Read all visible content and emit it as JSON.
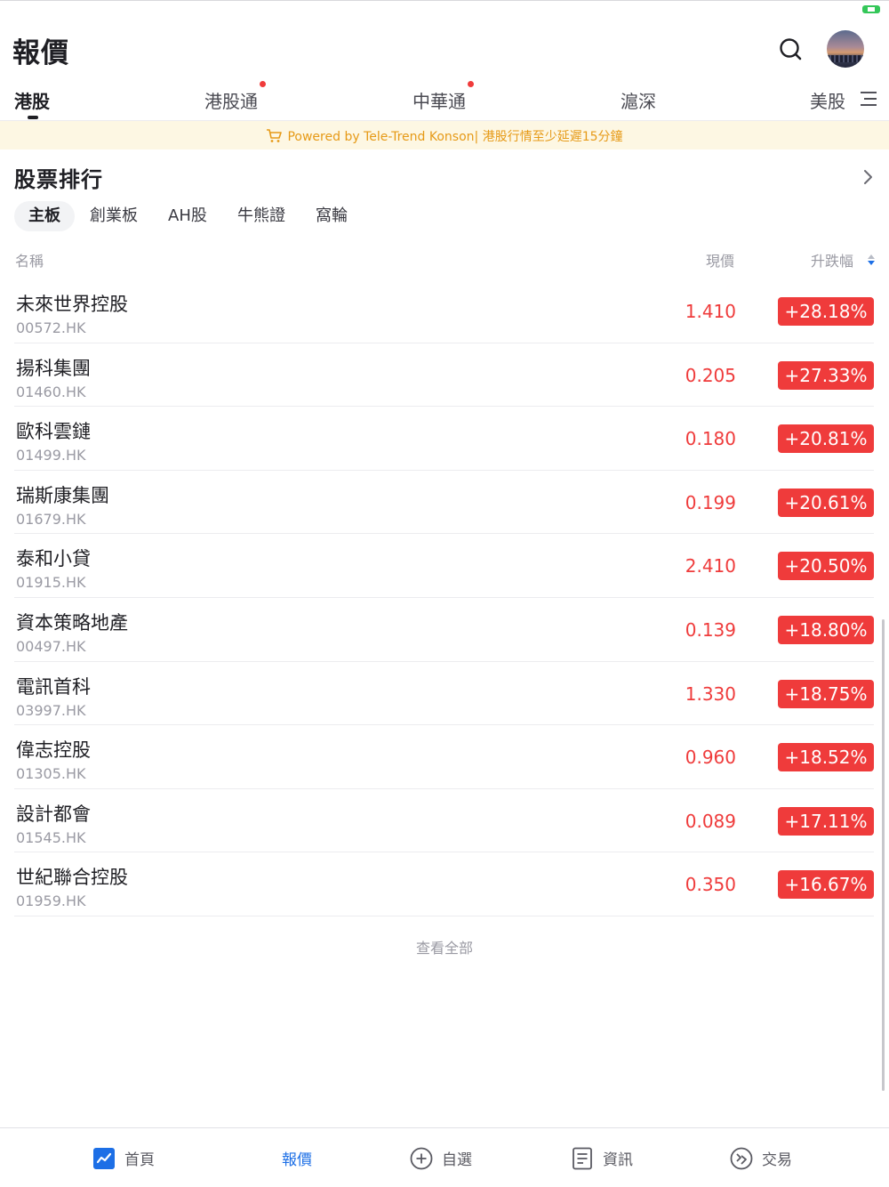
{
  "header": {
    "title": "報價"
  },
  "tabs": [
    {
      "label": "港股",
      "active": true,
      "dot": false
    },
    {
      "label": "港股通",
      "active": false,
      "dot": true
    },
    {
      "label": "中華通",
      "active": false,
      "dot": true
    },
    {
      "label": "滬深",
      "active": false,
      "dot": false
    },
    {
      "label": "美股",
      "active": false,
      "dot": false
    }
  ],
  "notice": {
    "text": "Powered by Tele-Trend Konson| 港股行情至少延遲15分鐘"
  },
  "ranking": {
    "title": "股票排行",
    "subtabs": [
      "主板",
      "創業板",
      "AH股",
      "牛熊證",
      "窩輪"
    ],
    "columns": {
      "name": "名稱",
      "price": "現價",
      "change": "升跌幅"
    },
    "rows": [
      {
        "name": "未來世界控股",
        "code": "00572.HK",
        "price": "1.410",
        "change": "+28.18%"
      },
      {
        "name": "揚科集團",
        "code": "01460.HK",
        "price": "0.205",
        "change": "+27.33%"
      },
      {
        "name": "歐科雲鏈",
        "code": "01499.HK",
        "price": "0.180",
        "change": "+20.81%"
      },
      {
        "name": "瑞斯康集團",
        "code": "01679.HK",
        "price": "0.199",
        "change": "+20.61%"
      },
      {
        "name": "泰和小貸",
        "code": "01915.HK",
        "price": "2.410",
        "change": "+20.50%"
      },
      {
        "name": "資本策略地產",
        "code": "00497.HK",
        "price": "0.139",
        "change": "+18.80%"
      },
      {
        "name": "電訊首科",
        "code": "03997.HK",
        "price": "1.330",
        "change": "+18.75%"
      },
      {
        "name": "偉志控股",
        "code": "01305.HK",
        "price": "0.960",
        "change": "+18.52%"
      },
      {
        "name": "設計都會",
        "code": "01545.HK",
        "price": "0.089",
        "change": "+17.11%"
      },
      {
        "name": "世紀聯合控股",
        "code": "01959.HK",
        "price": "0.350",
        "change": "+16.67%"
      }
    ],
    "view_all": "查看全部"
  },
  "bottom_nav": [
    {
      "label": "首頁",
      "icon": "chart-icon"
    },
    {
      "label": "報價",
      "icon": "",
      "active": true
    },
    {
      "label": "自選",
      "icon": "add-circle-icon"
    },
    {
      "label": "資訊",
      "icon": "document-icon"
    },
    {
      "label": "交易",
      "icon": "trade-icon"
    }
  ],
  "colors": {
    "up": "#ef3b3b",
    "accent": "#1d6fe6",
    "notice_bg": "#fdf7e3",
    "notice_text": "#e69a17"
  }
}
